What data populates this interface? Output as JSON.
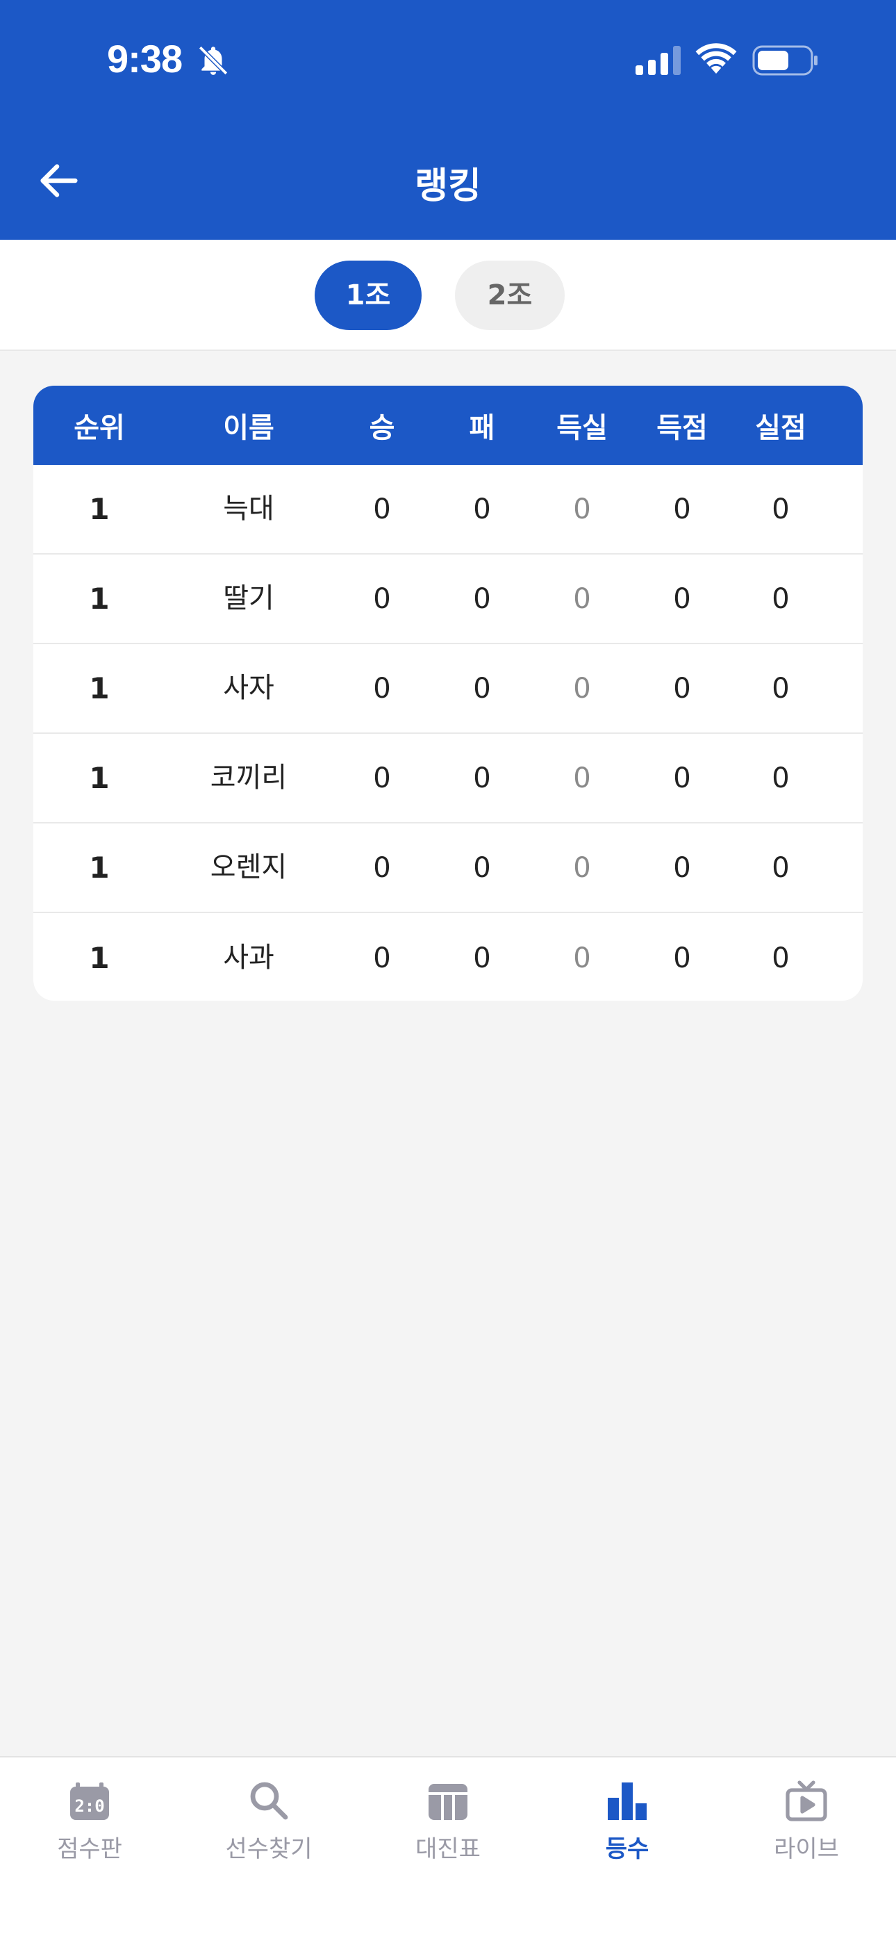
{
  "status_bar": {
    "time": "9:38"
  },
  "header": {
    "title": "랭킹"
  },
  "tabs": [
    {
      "label": "1조",
      "active": true
    },
    {
      "label": "2조",
      "active": false
    }
  ],
  "table": {
    "columns": [
      "순위",
      "이름",
      "승",
      "패",
      "득실",
      "득점",
      "실점"
    ],
    "rows": [
      {
        "rank": "1",
        "name": "늑대",
        "win": "0",
        "loss": "0",
        "diff": "0",
        "scored": "0",
        "conceded": "0"
      },
      {
        "rank": "1",
        "name": "딸기",
        "win": "0",
        "loss": "0",
        "diff": "0",
        "scored": "0",
        "conceded": "0"
      },
      {
        "rank": "1",
        "name": "사자",
        "win": "0",
        "loss": "0",
        "diff": "0",
        "scored": "0",
        "conceded": "0"
      },
      {
        "rank": "1",
        "name": "코끼리",
        "win": "0",
        "loss": "0",
        "diff": "0",
        "scored": "0",
        "conceded": "0"
      },
      {
        "rank": "1",
        "name": "오렌지",
        "win": "0",
        "loss": "0",
        "diff": "0",
        "scored": "0",
        "conceded": "0"
      },
      {
        "rank": "1",
        "name": "사과",
        "win": "0",
        "loss": "0",
        "diff": "0",
        "scored": "0",
        "conceded": "0"
      }
    ]
  },
  "bottom_nav": [
    {
      "label": "점수판",
      "icon": "scoreboard-icon",
      "active": false
    },
    {
      "label": "선수찾기",
      "icon": "search-icon",
      "active": false
    },
    {
      "label": "대진표",
      "icon": "bracket-icon",
      "active": false
    },
    {
      "label": "등수",
      "icon": "bar-chart-icon",
      "active": true
    },
    {
      "label": "라이브",
      "icon": "live-tv-icon",
      "active": false
    }
  ],
  "colors": {
    "primary": "#1c58c6",
    "inactive": "#9a9aa6",
    "background": "#f4f4f4"
  }
}
